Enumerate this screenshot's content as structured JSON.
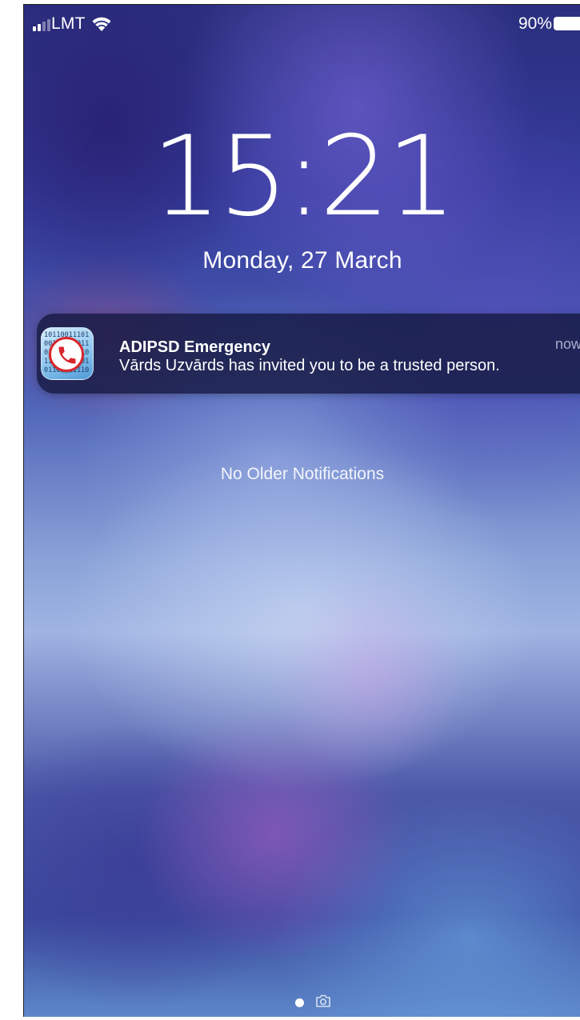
{
  "status_bar": {
    "carrier": "LMT",
    "battery_percent": "90%",
    "signal_bars_active": 2,
    "signal_bars_total": 4,
    "icons": [
      "signal-icon",
      "wifi-icon",
      "battery-icon"
    ]
  },
  "lock_screen": {
    "time": "15:21",
    "date": "Monday, 27 March",
    "no_older_label": "No Older Notifications"
  },
  "notification": {
    "app_name": "ADIPSD Emergency",
    "time": "now",
    "message": "Vārds Uzvārds has invited you to be a trusted person.",
    "icon": "emergency-phone-app-icon",
    "accent_color": "#d9262b"
  },
  "page_indicator": {
    "icons": [
      "page-dot-icon",
      "camera-icon"
    ]
  },
  "colors": {
    "text": "#ffffff",
    "notification_bg": "#161a42"
  }
}
